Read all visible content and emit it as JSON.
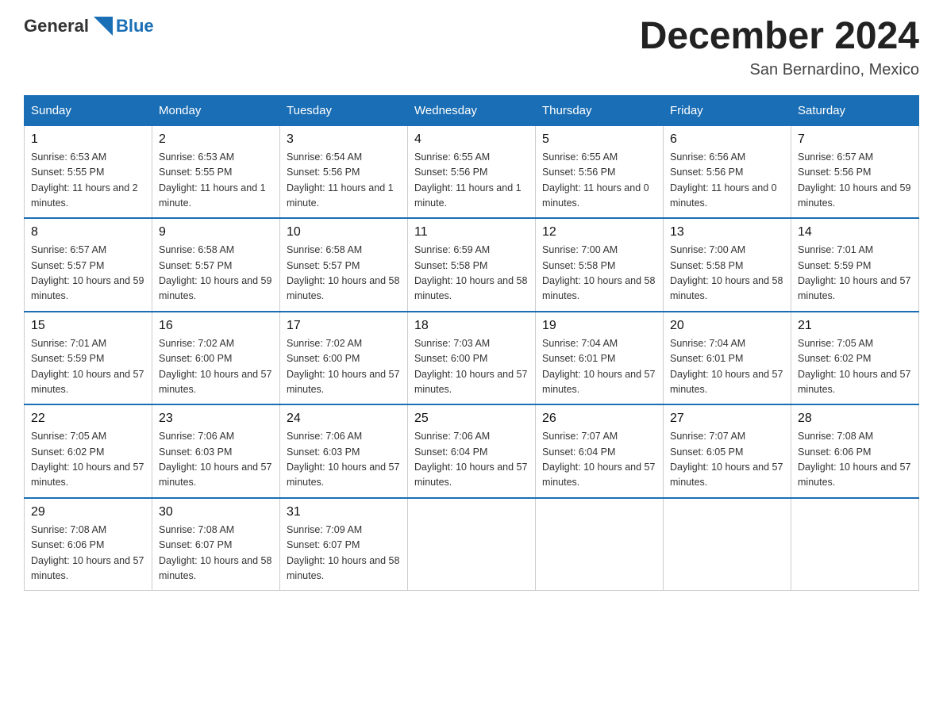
{
  "header": {
    "logo": {
      "general": "General",
      "blue": "Blue"
    },
    "title": "December 2024",
    "location": "San Bernardino, Mexico"
  },
  "days_of_week": [
    "Sunday",
    "Monday",
    "Tuesday",
    "Wednesday",
    "Thursday",
    "Friday",
    "Saturday"
  ],
  "weeks": [
    [
      {
        "day": "1",
        "sunrise": "6:53 AM",
        "sunset": "5:55 PM",
        "daylight": "11 hours and 2 minutes."
      },
      {
        "day": "2",
        "sunrise": "6:53 AM",
        "sunset": "5:55 PM",
        "daylight": "11 hours and 1 minute."
      },
      {
        "day": "3",
        "sunrise": "6:54 AM",
        "sunset": "5:56 PM",
        "daylight": "11 hours and 1 minute."
      },
      {
        "day": "4",
        "sunrise": "6:55 AM",
        "sunset": "5:56 PM",
        "daylight": "11 hours and 1 minute."
      },
      {
        "day": "5",
        "sunrise": "6:55 AM",
        "sunset": "5:56 PM",
        "daylight": "11 hours and 0 minutes."
      },
      {
        "day": "6",
        "sunrise": "6:56 AM",
        "sunset": "5:56 PM",
        "daylight": "11 hours and 0 minutes."
      },
      {
        "day": "7",
        "sunrise": "6:57 AM",
        "sunset": "5:56 PM",
        "daylight": "10 hours and 59 minutes."
      }
    ],
    [
      {
        "day": "8",
        "sunrise": "6:57 AM",
        "sunset": "5:57 PM",
        "daylight": "10 hours and 59 minutes."
      },
      {
        "day": "9",
        "sunrise": "6:58 AM",
        "sunset": "5:57 PM",
        "daylight": "10 hours and 59 minutes."
      },
      {
        "day": "10",
        "sunrise": "6:58 AM",
        "sunset": "5:57 PM",
        "daylight": "10 hours and 58 minutes."
      },
      {
        "day": "11",
        "sunrise": "6:59 AM",
        "sunset": "5:58 PM",
        "daylight": "10 hours and 58 minutes."
      },
      {
        "day": "12",
        "sunrise": "7:00 AM",
        "sunset": "5:58 PM",
        "daylight": "10 hours and 58 minutes."
      },
      {
        "day": "13",
        "sunrise": "7:00 AM",
        "sunset": "5:58 PM",
        "daylight": "10 hours and 58 minutes."
      },
      {
        "day": "14",
        "sunrise": "7:01 AM",
        "sunset": "5:59 PM",
        "daylight": "10 hours and 57 minutes."
      }
    ],
    [
      {
        "day": "15",
        "sunrise": "7:01 AM",
        "sunset": "5:59 PM",
        "daylight": "10 hours and 57 minutes."
      },
      {
        "day": "16",
        "sunrise": "7:02 AM",
        "sunset": "6:00 PM",
        "daylight": "10 hours and 57 minutes."
      },
      {
        "day": "17",
        "sunrise": "7:02 AM",
        "sunset": "6:00 PM",
        "daylight": "10 hours and 57 minutes."
      },
      {
        "day": "18",
        "sunrise": "7:03 AM",
        "sunset": "6:00 PM",
        "daylight": "10 hours and 57 minutes."
      },
      {
        "day": "19",
        "sunrise": "7:04 AM",
        "sunset": "6:01 PM",
        "daylight": "10 hours and 57 minutes."
      },
      {
        "day": "20",
        "sunrise": "7:04 AM",
        "sunset": "6:01 PM",
        "daylight": "10 hours and 57 minutes."
      },
      {
        "day": "21",
        "sunrise": "7:05 AM",
        "sunset": "6:02 PM",
        "daylight": "10 hours and 57 minutes."
      }
    ],
    [
      {
        "day": "22",
        "sunrise": "7:05 AM",
        "sunset": "6:02 PM",
        "daylight": "10 hours and 57 minutes."
      },
      {
        "day": "23",
        "sunrise": "7:06 AM",
        "sunset": "6:03 PM",
        "daylight": "10 hours and 57 minutes."
      },
      {
        "day": "24",
        "sunrise": "7:06 AM",
        "sunset": "6:03 PM",
        "daylight": "10 hours and 57 minutes."
      },
      {
        "day": "25",
        "sunrise": "7:06 AM",
        "sunset": "6:04 PM",
        "daylight": "10 hours and 57 minutes."
      },
      {
        "day": "26",
        "sunrise": "7:07 AM",
        "sunset": "6:04 PM",
        "daylight": "10 hours and 57 minutes."
      },
      {
        "day": "27",
        "sunrise": "7:07 AM",
        "sunset": "6:05 PM",
        "daylight": "10 hours and 57 minutes."
      },
      {
        "day": "28",
        "sunrise": "7:08 AM",
        "sunset": "6:06 PM",
        "daylight": "10 hours and 57 minutes."
      }
    ],
    [
      {
        "day": "29",
        "sunrise": "7:08 AM",
        "sunset": "6:06 PM",
        "daylight": "10 hours and 57 minutes."
      },
      {
        "day": "30",
        "sunrise": "7:08 AM",
        "sunset": "6:07 PM",
        "daylight": "10 hours and 58 minutes."
      },
      {
        "day": "31",
        "sunrise": "7:09 AM",
        "sunset": "6:07 PM",
        "daylight": "10 hours and 58 minutes."
      },
      null,
      null,
      null,
      null
    ]
  ],
  "labels": {
    "sunrise": "Sunrise:",
    "sunset": "Sunset:",
    "daylight": "Daylight:"
  }
}
